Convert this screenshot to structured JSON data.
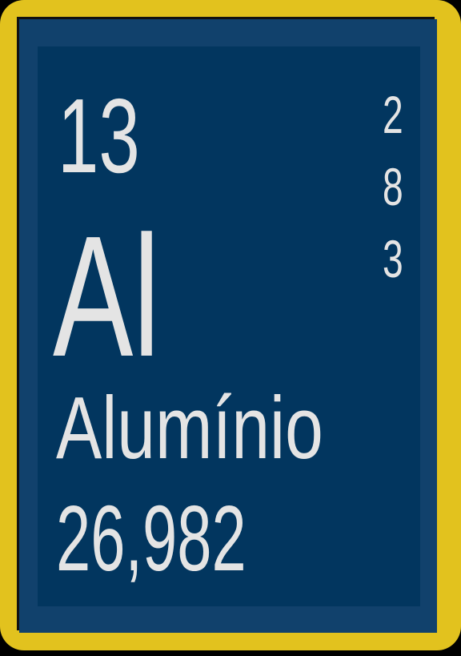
{
  "element": {
    "atomic_number": "13",
    "symbol": "Al",
    "name": "Alumínio",
    "atomic_mass": "26,982",
    "electron_shells": [
      "2",
      "8",
      "3"
    ]
  },
  "colors": {
    "frame": "#e2c21e",
    "outer": "#11416c",
    "inner": "#02365f",
    "text": "#e4e4e4"
  }
}
